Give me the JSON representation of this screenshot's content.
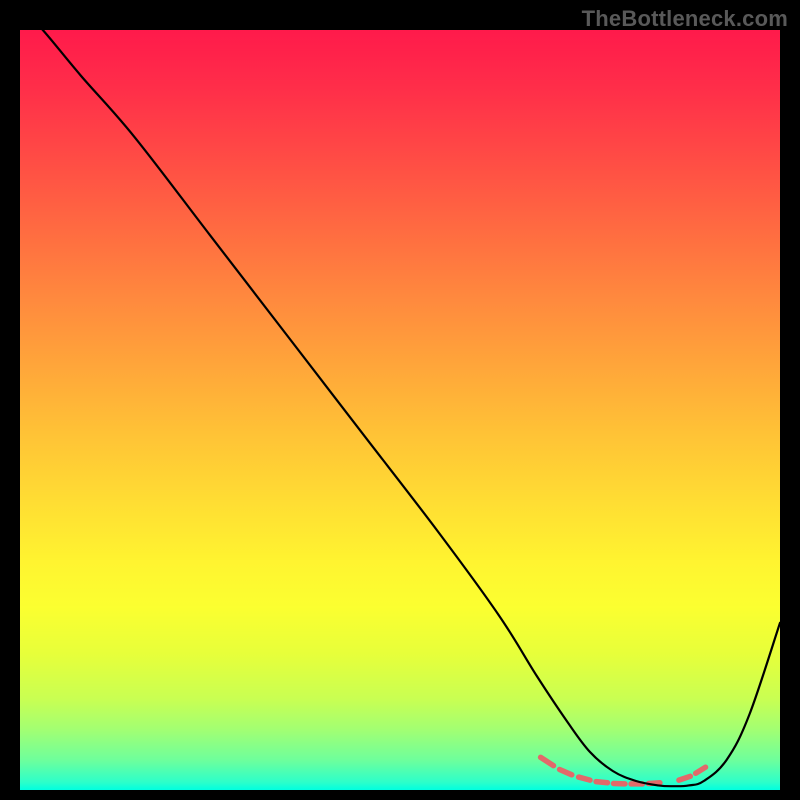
{
  "watermark": "TheBottleneck.com",
  "chart_data": {
    "type": "line",
    "title": "",
    "xlabel": "",
    "ylabel": "",
    "xlim": [
      0,
      100
    ],
    "ylim": [
      0,
      100
    ],
    "grid": false,
    "series": [
      {
        "name": "curve",
        "stroke": "#000000",
        "x": [
          0,
          3,
          8,
          15,
          25,
          35,
          45,
          55,
          63,
          68,
          72,
          75,
          78,
          81,
          84,
          86,
          88,
          90,
          93,
          96,
          100
        ],
        "y": [
          103,
          100,
          94,
          86,
          73,
          60,
          47,
          34,
          23,
          15,
          9,
          5,
          2.5,
          1.2,
          0.6,
          0.5,
          0.6,
          1.2,
          4,
          10,
          22
        ]
      }
    ],
    "markers": {
      "name": "bottom-dashes",
      "color": "#e26a6a",
      "stroke_width": 5.5,
      "segments": [
        {
          "x1": 68.5,
          "y1": 4.3,
          "x2": 70.2,
          "y2": 3.2
        },
        {
          "x1": 71.0,
          "y1": 2.7,
          "x2": 72.6,
          "y2": 2.0
        },
        {
          "x1": 73.5,
          "y1": 1.7,
          "x2": 75.0,
          "y2": 1.3
        },
        {
          "x1": 75.8,
          "y1": 1.1,
          "x2": 77.3,
          "y2": 0.95
        },
        {
          "x1": 78.1,
          "y1": 0.85,
          "x2": 79.6,
          "y2": 0.8
        },
        {
          "x1": 80.4,
          "y1": 0.8,
          "x2": 81.9,
          "y2": 0.8
        },
        {
          "x1": 82.7,
          "y1": 0.85,
          "x2": 84.2,
          "y2": 0.95
        },
        {
          "x1": 86.7,
          "y1": 1.3,
          "x2": 88.2,
          "y2": 1.8
        },
        {
          "x1": 88.9,
          "y1": 2.2,
          "x2": 90.2,
          "y2": 3.0
        }
      ]
    },
    "gradient_stops": [
      {
        "offset": 0,
        "color": "#ff1a4b"
      },
      {
        "offset": 8,
        "color": "#ff2f49"
      },
      {
        "offset": 17,
        "color": "#ff4c45"
      },
      {
        "offset": 26,
        "color": "#ff6a41"
      },
      {
        "offset": 35,
        "color": "#ff883e"
      },
      {
        "offset": 44,
        "color": "#ffa53a"
      },
      {
        "offset": 53,
        "color": "#ffc236"
      },
      {
        "offset": 62,
        "color": "#ffdd33"
      },
      {
        "offset": 70,
        "color": "#fff430"
      },
      {
        "offset": 76,
        "color": "#fbff30"
      },
      {
        "offset": 82,
        "color": "#e7ff3a"
      },
      {
        "offset": 88,
        "color": "#c9ff52"
      },
      {
        "offset": 92,
        "color": "#a3ff72"
      },
      {
        "offset": 96,
        "color": "#6fff9b"
      },
      {
        "offset": 99,
        "color": "#2cffca"
      },
      {
        "offset": 100,
        "color": "#00ffe0"
      }
    ]
  }
}
